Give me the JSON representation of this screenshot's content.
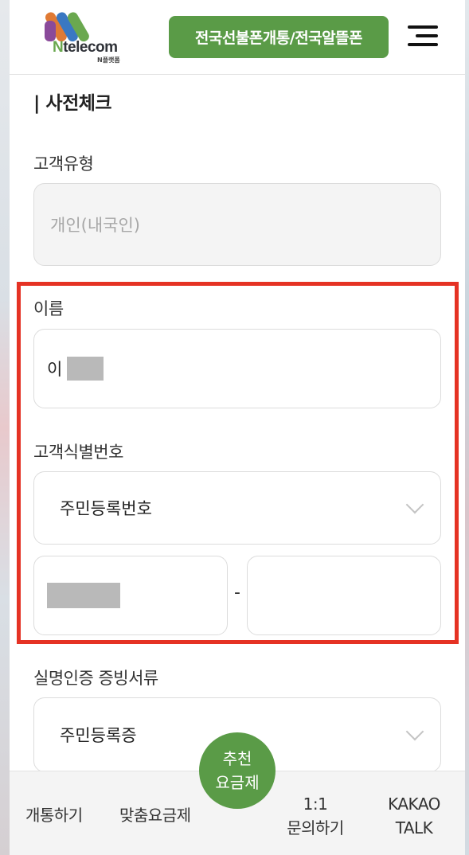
{
  "header": {
    "logo_text_n": "N",
    "logo_text_rest": "telecom",
    "logo_sub": "N플랫폼",
    "activation_button": "전국선불폰개통/전국알뜰폰"
  },
  "section_title": "| 사전체크",
  "customer_type": {
    "label": "고객유형",
    "value": "개인(내국인)"
  },
  "name": {
    "label": "이름",
    "value": "이"
  },
  "customer_id": {
    "label": "고객식별번호",
    "selected": "주민등록번호",
    "separator": "-"
  },
  "proof_document": {
    "label": "실명인증 증빙서류",
    "selected": "주민등록증"
  },
  "bottom_nav": {
    "activate": "개통하기",
    "custom_plan": "맞춤요금제",
    "recommend_line1": "추천",
    "recommend_line2": "요금제",
    "inquiry_line1": "1:1",
    "inquiry_line2": "문의하기",
    "kakao_line1": "KAKAO",
    "kakao_line2": "TALK"
  },
  "colors": {
    "brand_green": "#5a9b47",
    "highlight_red": "#e53224"
  }
}
